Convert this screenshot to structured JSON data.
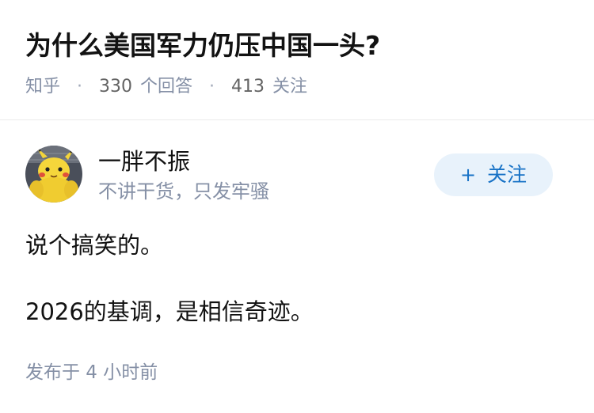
{
  "question": {
    "title": "为什么美国军力仍压中国一头?",
    "source": "知乎",
    "answers_count": "330",
    "answers_label": "个回答",
    "followers_count": "413",
    "followers_label": "关注",
    "separator": "·"
  },
  "answer": {
    "author": {
      "name": "一胖不振",
      "bio": "不讲干货，只发牢骚",
      "avatar_icon": "pikachu-plush-avatar"
    },
    "follow_button": {
      "icon": "+",
      "label": "关注"
    },
    "content": [
      "说个搞笑的。",
      "2026的基调，是相信奇迹。"
    ],
    "published": "发布于  4 小时前"
  },
  "colors": {
    "title": "#121212",
    "meta": "#8590a6",
    "follow_bg": "#e8f2fb",
    "follow_text": "#1772c6",
    "divider": "#ebebeb"
  }
}
